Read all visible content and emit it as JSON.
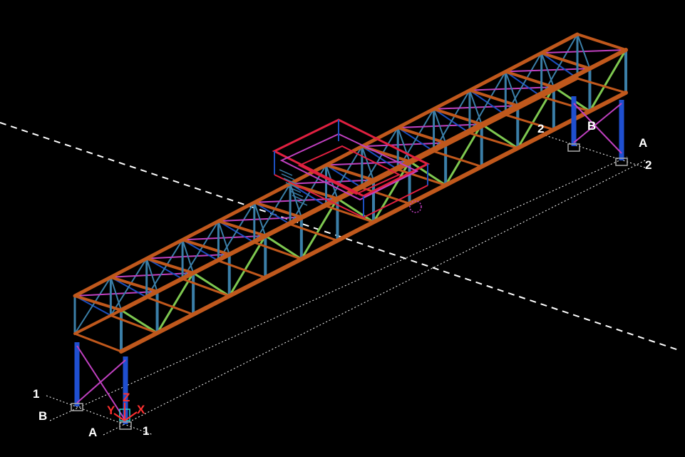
{
  "grid_labels": {
    "row_1_left": "1",
    "col_b_left": "B",
    "col_a_left": "A",
    "row_1_bottom": "1",
    "row_2_right": "2",
    "col_b_right": "B",
    "col_a_right": "A",
    "row_2_far_right": "2"
  },
  "ucs": {
    "y_label": "Y",
    "z_label": "Z",
    "x_label": "X"
  },
  "colors": {
    "background": "#000000",
    "chord": "#c0581c",
    "vertical": "#3b7fa8",
    "diagonal_green": "#7ec850",
    "diagonal_blue": "#1c4fbf",
    "bracing_magenta": "#c040c0",
    "column": "#1f4fd0",
    "gridline": "#ffffff",
    "platform_red": "#e02040",
    "ucs_red": "#ff3030"
  }
}
